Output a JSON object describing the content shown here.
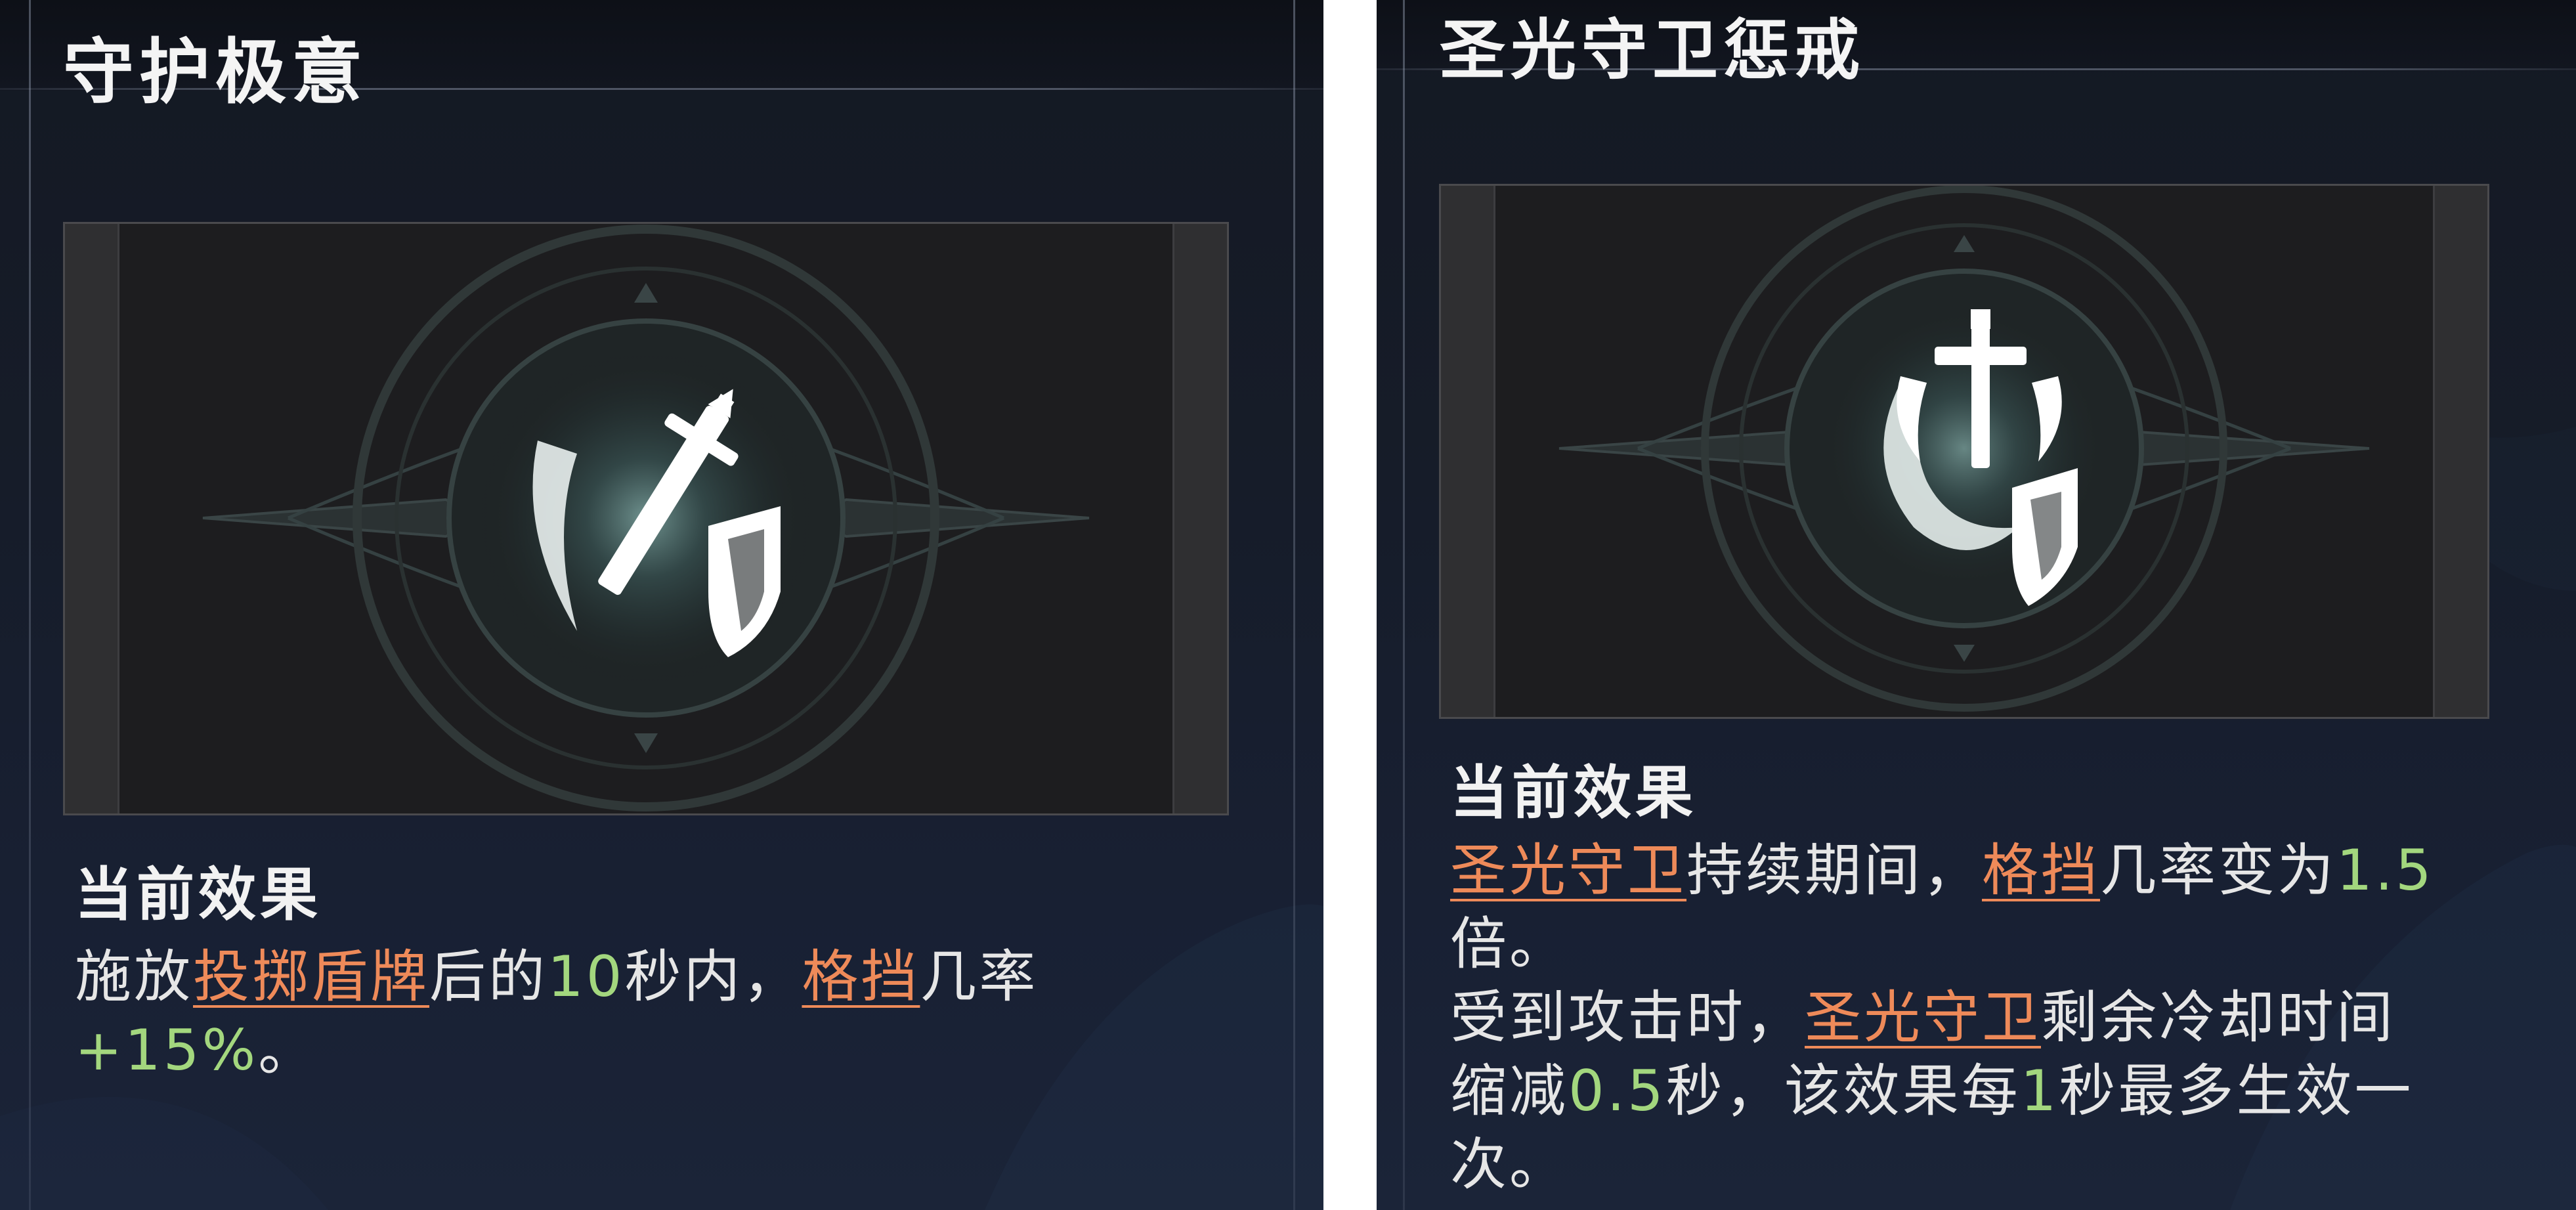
{
  "panels": [
    {
      "title": "守护极意",
      "icon": "sword-and-shield-icon",
      "effect_heading": "当前效果",
      "lines": [
        [
          {
            "t": "施放",
            "k": "text"
          },
          {
            "t": "投掷盾牌",
            "k": "kw"
          },
          {
            "t": "后的",
            "k": "text"
          },
          {
            "t": "10",
            "k": "num"
          },
          {
            "t": "秒内，",
            "k": "text"
          },
          {
            "t": "格挡",
            "k": "kw"
          },
          {
            "t": "几率",
            "k": "text"
          }
        ],
        [
          {
            "t": "+15%",
            "k": "num"
          },
          {
            "t": "。",
            "k": "text"
          }
        ]
      ]
    },
    {
      "title": "圣光守卫惩戒",
      "icon": "holy-cross-shield-icon",
      "effect_heading": "当前效果",
      "lines": [
        [
          {
            "t": "圣光守卫",
            "k": "kw"
          },
          {
            "t": "持续期间，",
            "k": "text"
          },
          {
            "t": "格挡",
            "k": "kw"
          },
          {
            "t": "几率变为",
            "k": "text"
          },
          {
            "t": "1.5",
            "k": "num"
          }
        ],
        [
          {
            "t": "倍。",
            "k": "text"
          }
        ],
        [
          {
            "t": "受到攻击时，",
            "k": "text"
          },
          {
            "t": "圣光守卫",
            "k": "kw"
          },
          {
            "t": "剩余冷却时间",
            "k": "text"
          }
        ],
        [
          {
            "t": "缩减",
            "k": "text"
          },
          {
            "t": "0.5",
            "k": "num"
          },
          {
            "t": "秒，该效果每",
            "k": "text"
          },
          {
            "t": "1",
            "k": "num"
          },
          {
            "t": "秒最多生效一",
            "k": "text"
          }
        ],
        [
          {
            "t": "次。",
            "k": "text"
          }
        ]
      ]
    }
  ],
  "colors": {
    "keyword": "#ee8a59",
    "number": "#a3d77e",
    "text": "#e6e6e6",
    "title": "#f4f4f4",
    "panel_bg": "#161c29"
  }
}
